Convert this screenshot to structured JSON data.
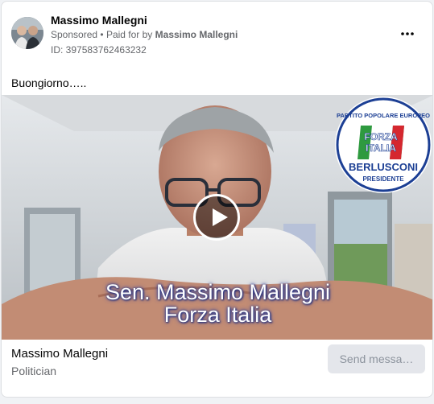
{
  "ad": {
    "advertiser_name": "Massimo Mallegni",
    "sponsored_label": "Sponsored",
    "paid_for_prefix": "Paid for by",
    "payer": "Massimo Mallegni",
    "ad_id": "ID: 397583762463232",
    "post_text": "Buongiorno….."
  },
  "video": {
    "caption_line1": "Sen. Massimo Mallegni",
    "caption_line2": "Forza Italia",
    "logo": {
      "arc_text": "PARTITO POPOLARE EUROPEO",
      "flag_text_line1": "FORZA",
      "flag_text_line2": "ITALIA",
      "name": "BERLUSCONI",
      "subtitle": "PRESIDENTE"
    }
  },
  "footer": {
    "page_name": "Massimo Mallegni",
    "page_category": "Politician",
    "cta_label": "Send messa…"
  },
  "colors": {
    "text_primary": "#050505",
    "text_secondary": "#65676b",
    "logo_blue": "#1c3f94",
    "button_bg": "#e4e6eb"
  },
  "icons": {
    "more": "more-horizontal-icon",
    "play": "play-icon"
  }
}
